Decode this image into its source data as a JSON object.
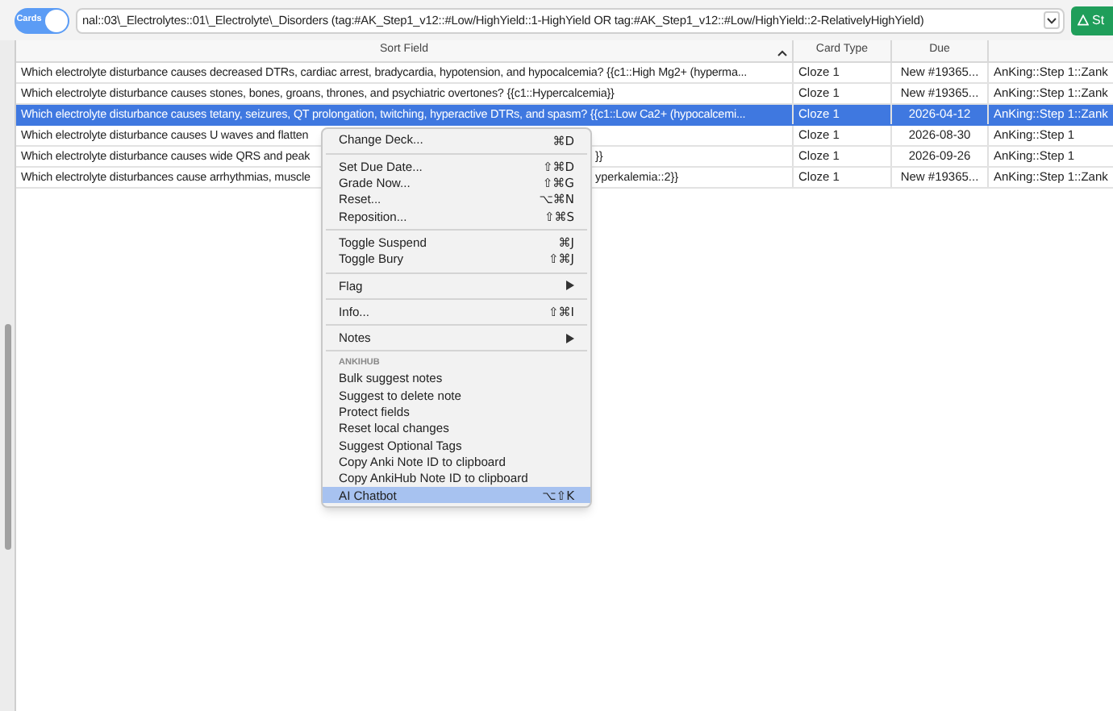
{
  "toolbar": {
    "toggle": {
      "label": "Cards",
      "on": true
    },
    "search": {
      "value": "nal::03\\_Electrolytes::01\\_Electrolyte\\_Disorders (tag:#AK_Step1_v12::#Low/HighYield::1-HighYield OR tag:#AK_Step1_v12::#Low/HighYield::2-RelativelyHighYield)"
    },
    "button": {
      "label": "St"
    }
  },
  "table": {
    "columns": [
      "Sort Field",
      "Card Type",
      "Due"
    ],
    "rows": [
      {
        "sort_field": "Which electrolyte disturbance causes decreased DTRs, cardiac arrest, bradycardia, hypotension, and hypocalcemia?   {{c1::High Mg2+ (hyperma...",
        "card_type": "Cloze 1",
        "due": "New #19365...",
        "deck": "AnKing::Step 1::Zank",
        "selected": false
      },
      {
        "sort_field": "Which electrolyte disturbance causes stones, bones, groans, thrones, and psychiatric overtones?  {{c1::Hypercalcemia}}",
        "card_type": "Cloze 1",
        "due": "New #19365...",
        "deck": "AnKing::Step 1::Zank",
        "selected": false
      },
      {
        "sort_field": "Which electrolyte disturbance causes tetany, seizures, QT prolongation, twitching, hyperactive DTRs, and spasm?   {{c1::Low Ca2+ (hypocalcemi...",
        "card_type": "Cloze 1",
        "due": "2026-04-12",
        "deck": "AnKing::Step 1::Zank",
        "selected": true
      },
      {
        "sort_field": "Which electrolyte disturbance causes U waves and flatten",
        "card_type": "Cloze 1",
        "due": "2026-08-30",
        "deck": "AnKing::Step 1",
        "selected": false
      },
      {
        "sort_field": "Which electrolyte disturbance causes wide QRS and peak",
        "tail": "}}",
        "card_type": "Cloze 1",
        "due": "2026-09-26",
        "deck": "AnKing::Step 1",
        "selected": false
      },
      {
        "sort_field": "Which electrolyte disturbances cause arrhythmias, muscle",
        "tail": "yperkalemia::2}}",
        "card_type": "Cloze 1",
        "due": "New #19365...",
        "deck": "AnKing::Step 1::Zank",
        "selected": false
      }
    ]
  },
  "context_menu": [
    {
      "kind": "item",
      "label": "Change Deck...",
      "shortcut": "⌘D",
      "submenu": false,
      "selected": false
    },
    {
      "kind": "separator"
    },
    {
      "kind": "item",
      "label": "Set Due Date...",
      "shortcut": "⇧⌘D",
      "submenu": false,
      "selected": false
    },
    {
      "kind": "item",
      "label": "Grade Now...",
      "shortcut": "⇧⌘G",
      "submenu": false,
      "selected": false
    },
    {
      "kind": "item",
      "label": "Reset...",
      "shortcut": "⌥⌘N",
      "submenu": false,
      "selected": false
    },
    {
      "kind": "item",
      "label": "Reposition...",
      "shortcut": "⇧⌘S",
      "submenu": false,
      "selected": false
    },
    {
      "kind": "separator"
    },
    {
      "kind": "item",
      "label": "Toggle Suspend",
      "shortcut": "⌘J",
      "submenu": false,
      "selected": false
    },
    {
      "kind": "item",
      "label": "Toggle Bury",
      "shortcut": "⇧⌘J",
      "submenu": false,
      "selected": false
    },
    {
      "kind": "separator"
    },
    {
      "kind": "item",
      "label": "Flag",
      "submenu": true,
      "selected": false
    },
    {
      "kind": "separator"
    },
    {
      "kind": "item",
      "label": "Info...",
      "shortcut": "⇧⌘I",
      "submenu": false,
      "selected": false
    },
    {
      "kind": "separator"
    },
    {
      "kind": "item",
      "label": "Notes",
      "submenu": true,
      "selected": false
    },
    {
      "kind": "separator"
    },
    {
      "kind": "header",
      "label": "ANKIHUB"
    },
    {
      "kind": "item",
      "label": "Bulk suggest notes",
      "submenu": false,
      "selected": false
    },
    {
      "kind": "item",
      "label": "Suggest to delete note",
      "submenu": false,
      "selected": false
    },
    {
      "kind": "item",
      "label": "Protect fields",
      "submenu": false,
      "selected": false
    },
    {
      "kind": "item",
      "label": "Reset local changes",
      "submenu": false,
      "selected": false
    },
    {
      "kind": "item",
      "label": "Suggest Optional Tags",
      "submenu": false,
      "selected": false
    },
    {
      "kind": "item",
      "label": "Copy Anki Note ID to clipboard",
      "submenu": false,
      "selected": false
    },
    {
      "kind": "item",
      "label": "Copy AnkiHub Note ID to clipboard",
      "submenu": false,
      "selected": false
    },
    {
      "kind": "item",
      "label": "AI Chatbot",
      "shortcut": "⌥⇧K",
      "submenu": false,
      "selected": true
    }
  ]
}
